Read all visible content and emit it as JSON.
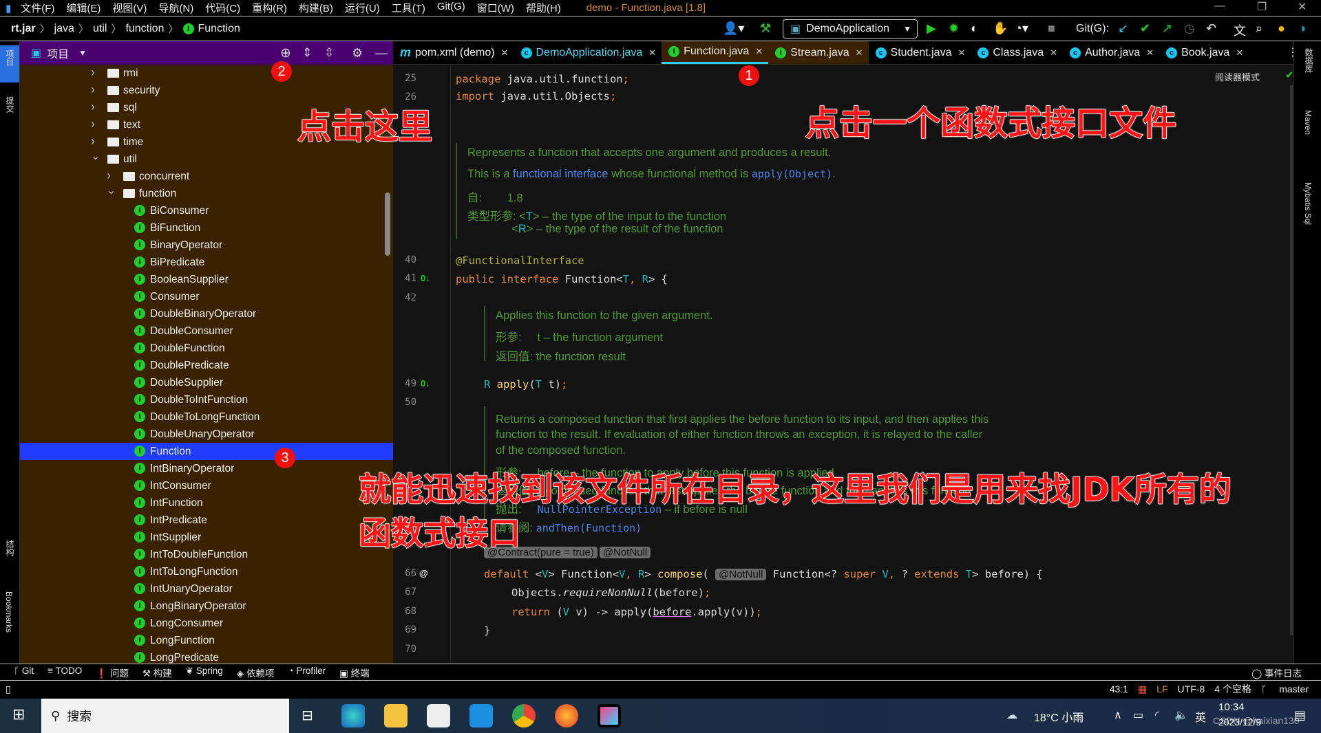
{
  "window": {
    "title": "demo - Function.java [1.8]",
    "menu": [
      "文件(F)",
      "编辑(E)",
      "视图(V)",
      "导航(N)",
      "代码(C)",
      "重构(R)",
      "构建(B)",
      "运行(U)",
      "工具(T)",
      "Git(G)",
      "窗口(W)",
      "帮助(H)"
    ]
  },
  "breadcrumb": [
    "rt.jar",
    "java",
    "util",
    "function",
    "Function"
  ],
  "toolbar": {
    "run_config": "DemoApplication",
    "git_label": "Git(G):"
  },
  "left_strip": [
    "项目",
    "提交",
    "结构",
    "Bookmarks"
  ],
  "right_strip": [
    "数据库",
    "Maven",
    "Mybatis Sql"
  ],
  "project_panel": {
    "title": "项目"
  },
  "tree": [
    {
      "label": "rmi",
      "type": "folder",
      "level": 0,
      "expanded": false
    },
    {
      "label": "security",
      "type": "folder",
      "level": 0,
      "expanded": false
    },
    {
      "label": "sql",
      "type": "folder",
      "level": 0,
      "expanded": false
    },
    {
      "label": "text",
      "type": "folder",
      "level": 0,
      "expanded": false
    },
    {
      "label": "time",
      "type": "folder",
      "level": 0,
      "expanded": false
    },
    {
      "label": "util",
      "type": "folder",
      "level": 0,
      "expanded": true
    },
    {
      "label": "concurrent",
      "type": "folder",
      "level": 1,
      "expanded": false
    },
    {
      "label": "function",
      "type": "folder",
      "level": 1,
      "expanded": true
    },
    {
      "label": "BiConsumer",
      "type": "interface"
    },
    {
      "label": "BiFunction",
      "type": "interface"
    },
    {
      "label": "BinaryOperator",
      "type": "interface"
    },
    {
      "label": "BiPredicate",
      "type": "interface"
    },
    {
      "label": "BooleanSupplier",
      "type": "interface"
    },
    {
      "label": "Consumer",
      "type": "interface"
    },
    {
      "label": "DoubleBinaryOperator",
      "type": "interface"
    },
    {
      "label": "DoubleConsumer",
      "type": "interface"
    },
    {
      "label": "DoubleFunction",
      "type": "interface"
    },
    {
      "label": "DoublePredicate",
      "type": "interface"
    },
    {
      "label": "DoubleSupplier",
      "type": "interface"
    },
    {
      "label": "DoubleToIntFunction",
      "type": "interface"
    },
    {
      "label": "DoubleToLongFunction",
      "type": "interface"
    },
    {
      "label": "DoubleUnaryOperator",
      "type": "interface"
    },
    {
      "label": "Function",
      "type": "interface",
      "selected": true
    },
    {
      "label": "IntBinaryOperator",
      "type": "interface"
    },
    {
      "label": "IntConsumer",
      "type": "interface"
    },
    {
      "label": "IntFunction",
      "type": "interface"
    },
    {
      "label": "IntPredicate",
      "type": "interface"
    },
    {
      "label": "IntSupplier",
      "type": "interface"
    },
    {
      "label": "IntToDoubleFunction",
      "type": "interface"
    },
    {
      "label": "IntToLongFunction",
      "type": "interface"
    },
    {
      "label": "IntUnaryOperator",
      "type": "interface"
    },
    {
      "label": "LongBinaryOperator",
      "type": "interface"
    },
    {
      "label": "LongConsumer",
      "type": "interface"
    },
    {
      "label": "LongFunction",
      "type": "interface"
    },
    {
      "label": "LongPredicate",
      "type": "interface"
    }
  ],
  "tabs": [
    {
      "label": "pom.xml (demo)",
      "icon": "m",
      "style": "plain"
    },
    {
      "label": "DemoApplication.java",
      "icon": "c",
      "style": "blue"
    },
    {
      "label": "Function.java",
      "icon": "i",
      "style": "active"
    },
    {
      "label": "Stream.java",
      "icon": "i",
      "style": "brown"
    },
    {
      "label": "Student.java",
      "icon": "c",
      "style": "plain"
    },
    {
      "label": "Class.java",
      "icon": "c",
      "style": "plain"
    },
    {
      "label": "Author.java",
      "icon": "c",
      "style": "plain"
    },
    {
      "label": "Book.java",
      "icon": "c",
      "style": "plain"
    }
  ],
  "editor": {
    "reader_mode": "阅读器模式",
    "line_numbers": [
      {
        "n": "25",
        "row": 0
      },
      {
        "n": "26",
        "row": 1
      },
      {
        "n": "40",
        "row": 2
      },
      {
        "n": "41",
        "row": 3
      },
      {
        "n": "42",
        "row": 4
      },
      {
        "n": "49",
        "row": 5
      },
      {
        "n": "50",
        "row": 6
      },
      {
        "n": "66",
        "row": 7
      },
      {
        "n": "67",
        "row": 8
      },
      {
        "n": "68",
        "row": 9
      },
      {
        "n": "69",
        "row": 10
      },
      {
        "n": "70",
        "row": 11
      }
    ],
    "code": [
      {
        "row": "a",
        "tokens": [
          [
            "package ",
            "kw"
          ],
          [
            "java.util.function",
            "pl"
          ],
          [
            ";",
            "kw"
          ]
        ]
      },
      {
        "row": "imp",
        "tokens": [
          [
            "import ",
            "kw"
          ],
          [
            "java.util.Objects",
            "pl"
          ],
          [
            ";",
            "kw"
          ]
        ]
      },
      {
        "row": "40",
        "tokens": [
          [
            "@FunctionalInterface",
            "an"
          ]
        ]
      },
      {
        "row": "41",
        "tokens": [
          [
            "public interface ",
            "kw"
          ],
          [
            "Function<",
            "pl"
          ],
          [
            "T",
            "tp"
          ],
          [
            ", ",
            "kw"
          ],
          [
            "R",
            "tp"
          ],
          [
            "> {",
            "pl"
          ]
        ]
      },
      {
        "row": "49",
        "tokens": [
          [
            "R ",
            "tp"
          ],
          [
            "apply",
            "fn"
          ],
          [
            "(",
            "pl"
          ],
          [
            "T ",
            "tp"
          ],
          [
            "t)",
            "pl"
          ],
          [
            ";",
            "kw"
          ]
        ]
      },
      {
        "row": "66",
        "tokens": [
          [
            "default ",
            "kw"
          ],
          [
            "<",
            "pl"
          ],
          [
            "V",
            "tp"
          ],
          [
            "> Function<",
            "pl"
          ],
          [
            "V",
            "tp"
          ],
          [
            ", ",
            "kw"
          ],
          [
            "R",
            "tp"
          ],
          [
            "> ",
            "pl"
          ],
          [
            "compose",
            "fn"
          ],
          [
            "( ",
            "pl"
          ],
          [
            "@NotNull",
            "hint"
          ],
          [
            " Function<? ",
            "pl"
          ],
          [
            "super ",
            "kw"
          ],
          [
            "V",
            "tp"
          ],
          [
            ", ",
            "kw"
          ],
          [
            "? ",
            "pl"
          ],
          [
            "extends ",
            "kw"
          ],
          [
            "T",
            "tp"
          ],
          [
            "> before) {",
            "pl"
          ]
        ]
      },
      {
        "row": "67",
        "tokens": [
          [
            "Objects.",
            "pl"
          ],
          [
            "requireNonNull",
            "it"
          ],
          [
            "(before)",
            "pl"
          ],
          [
            ";",
            "kw"
          ]
        ]
      },
      {
        "row": "68",
        "tokens": [
          [
            "return ",
            "kw"
          ],
          [
            "(",
            "pl"
          ],
          [
            "V ",
            "tp"
          ],
          [
            "v) -> apply(",
            "pl"
          ],
          [
            "before",
            "ul"
          ],
          [
            ".apply(v))",
            "pl"
          ],
          [
            ";",
            "kw"
          ]
        ]
      },
      {
        "row": "69",
        "tokens": [
          [
            "}",
            "pl"
          ]
        ]
      }
    ],
    "doc1": [
      [
        [
          "Represents a function that accepts one argument and produces a result.",
          ""
        ]
      ],
      [
        [
          "This is a ",
          ""
        ],
        [
          "functional interface",
          "link"
        ],
        [
          " whose functional method is ",
          ""
        ],
        [
          "apply(Object)",
          "dl"
        ],
        [
          ".",
          ""
        ]
      ],
      [
        [
          "自:        1.8",
          ""
        ]
      ],
      [
        [
          "类型形参: <",
          ""
        ],
        [
          "T",
          "tp"
        ],
        [
          "> – the type of the input to the function",
          ""
        ]
      ],
      [
        [
          "              <",
          ""
        ],
        [
          "R",
          "tp"
        ],
        [
          "> – the type of the result of the function",
          ""
        ]
      ]
    ],
    "doc2": [
      [
        [
          "Applies this function to the given argument.",
          ""
        ]
      ],
      [
        [
          "形参:     t – the function argument",
          ""
        ]
      ],
      [
        [
          "返回值: the function result",
          ""
        ]
      ]
    ],
    "doc3": [
      [
        [
          "Returns a composed function that first applies the before function to its input, and then applies this",
          ""
        ]
      ],
      [
        [
          "function to the result. If evaluation of either function throws an exception, it is relayed to the caller",
          ""
        ]
      ],
      [
        [
          "of the composed function.",
          ""
        ]
      ],
      [
        [
          "形参:     before – the function to apply before this function is applied",
          ""
        ]
      ],
      [
        [
          "返回值: a composed function that first applies the before function and then applies this function",
          ""
        ]
      ],
      [
        [
          "抛出:     ",
          ""
        ],
        [
          "NullPointerException",
          "dl"
        ],
        [
          " – if before is null",
          ""
        ]
      ],
      [
        [
          "请参阅: ",
          ""
        ],
        [
          "andThen(Function)",
          "dl"
        ]
      ]
    ],
    "hints": [
      "@Contract(pure = true)",
      "@NotNull"
    ]
  },
  "annotations": {
    "click_here": "点击这里",
    "click_file": "点击一个函数式接口文件",
    "explain_line1": "就能迅速找到该文件所在目录，这里我们是用来找JDK所有的",
    "explain_line2": "函数式接口",
    "badges": [
      "1",
      "2",
      "3"
    ],
    "badge_color": "#f01010"
  },
  "bottom_tools": [
    "Git",
    "TODO",
    "问题",
    "构建",
    "Spring",
    "依赖项",
    "Profiler",
    "终端"
  ],
  "event_log": "事件日志",
  "status": {
    "position": "43:1",
    "line_sep": "LF",
    "encoding": "UTF-8",
    "indent": "4 个空格",
    "branch": "master"
  },
  "taskbar": {
    "search": "搜索",
    "weather": "18°C 小雨",
    "ime": "英",
    "time": "10:34",
    "date": "2023/12/9",
    "watermark": "CSDN @haixian130"
  }
}
